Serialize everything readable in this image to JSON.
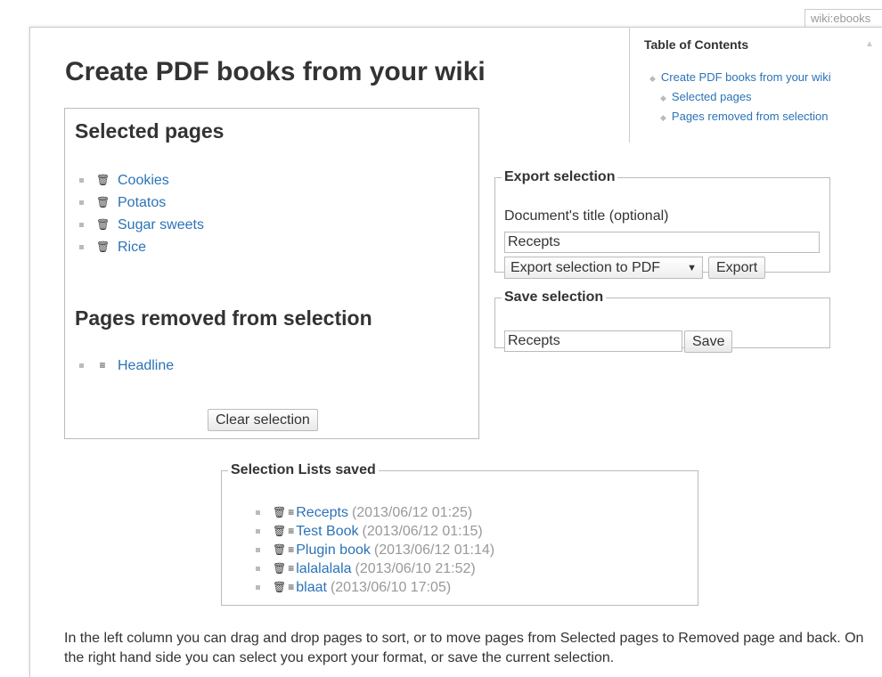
{
  "page_id": "wiki:ebooks",
  "toc": {
    "heading": "Table of Contents",
    "toggle": "▲",
    "items": [
      {
        "label": "Create PDF books from your wiki"
      },
      {
        "label": "Selected pages"
      },
      {
        "label": "Pages removed from selection"
      }
    ]
  },
  "title": "Create PDF books from your wiki",
  "selected": {
    "heading": "Selected pages",
    "items": [
      {
        "label": "Cookies"
      },
      {
        "label": "Potatos"
      },
      {
        "label": "Sugar sweets"
      },
      {
        "label": "Rice"
      }
    ]
  },
  "removed": {
    "heading": "Pages removed from selection",
    "items": [
      {
        "label": "Headline"
      }
    ]
  },
  "clear_button": "Clear selection",
  "export": {
    "legend": "Export selection",
    "title_label": "Document's title (optional)",
    "title_value": "Recepts",
    "format_selected": "Export selection to PDF",
    "export_button": "Export"
  },
  "save": {
    "legend": "Save selection",
    "name_value": "Recepts",
    "save_button": "Save"
  },
  "saved_lists": {
    "legend": "Selection Lists saved",
    "items": [
      {
        "name": "Recepts",
        "date": "(2013/06/12 01:25)"
      },
      {
        "name": "Test Book",
        "date": "(2013/06/12 01:15)"
      },
      {
        "name": "Plugin book",
        "date": "(2013/06/12 01:14)"
      },
      {
        "name": "lalalalala",
        "date": "(2013/06/10 21:52)"
      },
      {
        "name": "blaat",
        "date": "(2013/06/10 17:05)"
      }
    ]
  },
  "description": "In the left column you can drag and drop pages to sort, or to move pages from Selected pages to Removed page and back. On the right hand side you can select you export your format, or save the current selection.",
  "icons": {
    "bin": "🗑",
    "list": "≡"
  },
  "colors": {
    "link": "#2b73b7",
    "text": "#333333",
    "muted": "#999999",
    "border": "#bbbbbb"
  }
}
